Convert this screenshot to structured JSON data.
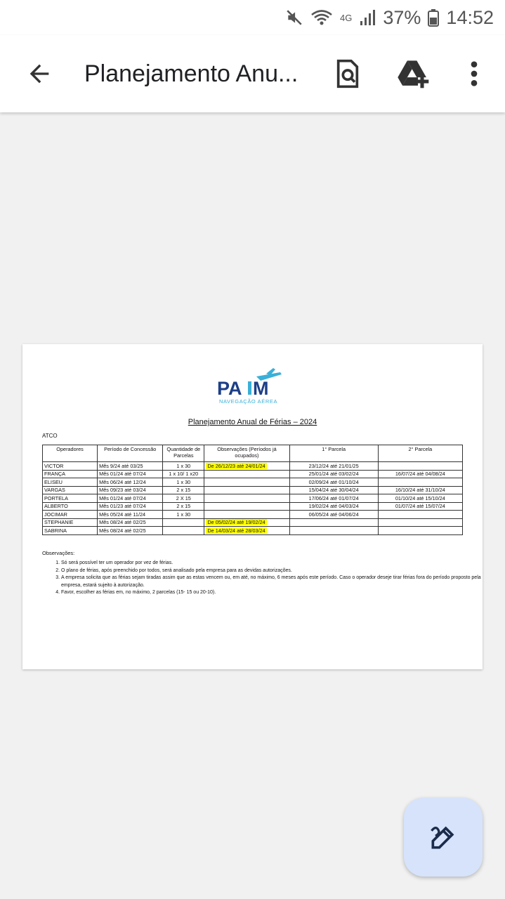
{
  "status_bar": {
    "network": "4G",
    "battery": "37%",
    "time": "14:52"
  },
  "toolbar": {
    "title": "Planejamento Anu...",
    "icons": [
      "back-arrow-icon",
      "find-in-page-icon",
      "add-to-drive-icon",
      "more-vert-icon"
    ]
  },
  "document": {
    "logo_text": "PAIM",
    "logo_subtext": "NAVEGAÇÃO AÉREA",
    "title": "Planejamento Anual de Férias – 2024",
    "section": "ATCO",
    "table": {
      "headers": [
        "Operadores",
        "Período de Concessão",
        "Quantidade de Parcelas",
        "Observações (Períodos já ocupados)",
        "1° Parcela",
        "2° Parcela"
      ],
      "rows": [
        [
          "VICTOR",
          "Mês 9/24 até 03/25",
          "1 x 30",
          "De 26/12/23 até 24/01/24",
          "23/12/24 até 21/01/25",
          ""
        ],
        [
          "FRANÇA",
          "Mês 01/24 até 07/24",
          "1 x 10/ 1 x20",
          "",
          "25/01/24 até 03/02/24",
          "16/07/24 até 04/08/24"
        ],
        [
          "ELISEU",
          "Mês 06/24 até 12/24",
          "1 x 30",
          "",
          "02/09/24 até 01/10/24",
          ""
        ],
        [
          "VARGAS",
          "Mês 09/23 até 03/24",
          "2 x 15",
          "",
          "15/04/24 até 30/04/24",
          "16/10/24 até 31/10/24"
        ],
        [
          "PORTELA",
          "Mês 01/24 até 07/24",
          "2 X 15",
          "",
          "17/06/24 até 01/07/24",
          "01/10/24 até 15/10/24"
        ],
        [
          "ALBERTO",
          "Mês 01/23 até 07/24",
          "2 x 15",
          "",
          "19/02/24 até 04/03/24",
          "01/07/24 até 15/07/24"
        ],
        [
          "JOCIMAR",
          "Mês 05/24 até 11/24",
          "1 x 30",
          "",
          "06/05/24 até 04/06/24",
          ""
        ],
        [
          "STEPHANIE",
          "Mês 08/24 até 02/25",
          "",
          "De 05/02/24 até 19/02/24",
          "",
          ""
        ],
        [
          "SABRINA",
          "Mês 08/24 até 02/25",
          "",
          "De 14/03/24 até 28/03/24",
          "",
          ""
        ]
      ],
      "highlight_color": "#ffff00"
    },
    "observations_title": "Observações:",
    "observations": [
      "Só será possível ter um operador por vez de férias.",
      "O plano de férias, após preenchido por todos, será analisado pela empresa para as devidas autorizações.",
      "A empresa solicita que as férias sejam tiradas assim que as estas vencem ou, em até, no máximo, 6 meses após este período. Caso o operador deseje tirar férias fora do período proposto pela empresa, estará sujeito à autorização.",
      "Favor, escolher as férias em, no máximo, 2 parcelas (15- 15 ou 20-10)."
    ]
  },
  "fab": {
    "icon": "edit-pen-icon",
    "color": "#d6e3fb"
  }
}
